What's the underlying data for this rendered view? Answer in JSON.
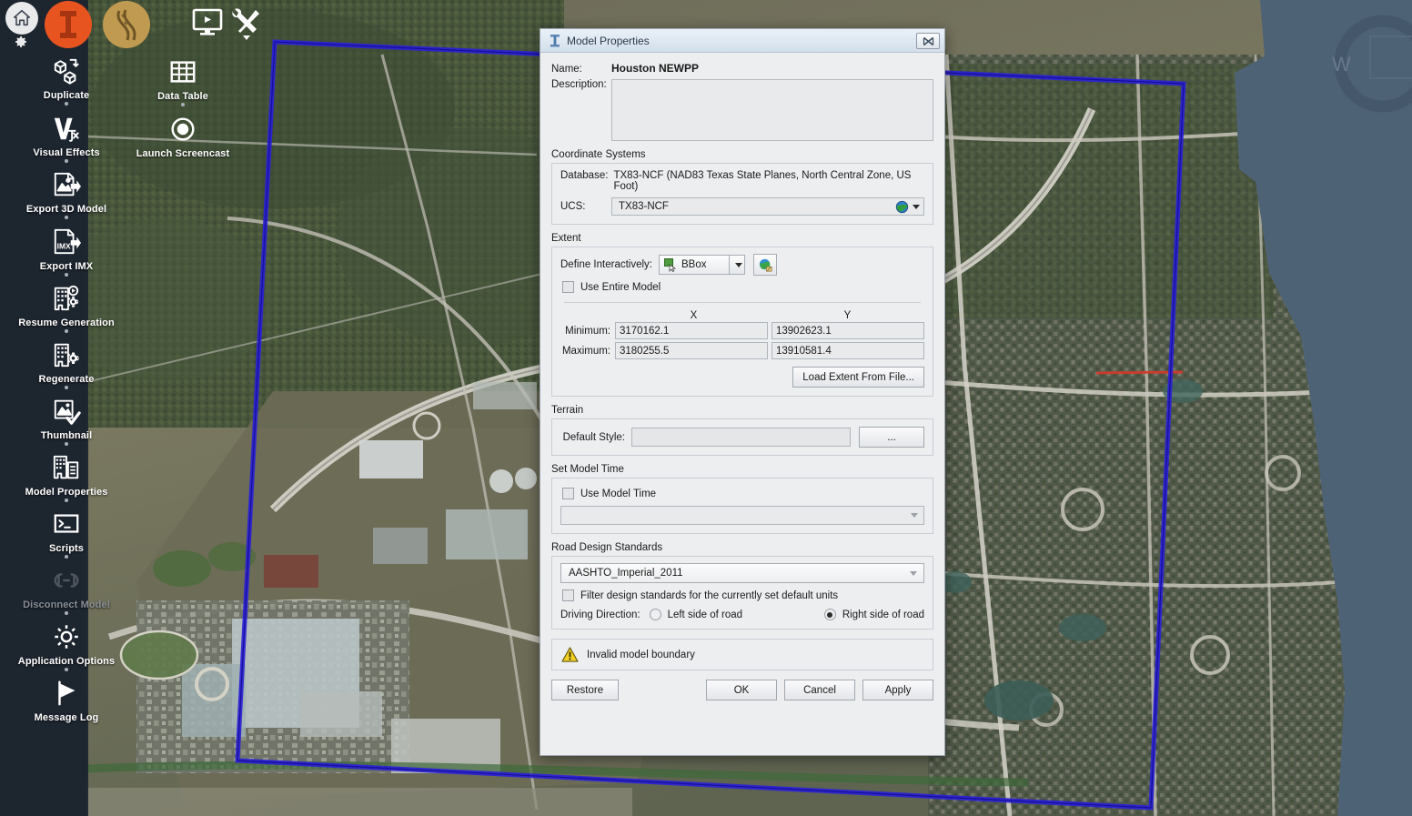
{
  "app": {
    "top_buttons": [
      {
        "name": "home-button",
        "icon": "home-icon",
        "label": "Home"
      },
      {
        "name": "settings-gear-button",
        "icon": "gear-icon",
        "label": "Settings"
      },
      {
        "name": "infraworks-logo-button",
        "icon": "infraworks-logo-icon",
        "label": "InfraWorks"
      },
      {
        "name": "roadway-design-button",
        "icon": "road-icon",
        "label": "Roadway Design"
      },
      {
        "name": "screencast-button",
        "icon": "screencast-monitor-icon",
        "label": "Screencast"
      },
      {
        "name": "tools-button",
        "icon": "wrench-screwdriver-icon",
        "label": "Tools"
      }
    ],
    "viewcube_label": "W"
  },
  "sidebar": {
    "column1": [
      {
        "label": "Duplicate",
        "icon": "duplicate-cubes-icon",
        "disabled": false
      },
      {
        "label": "Visual Effects",
        "icon": "visual-effects-icon",
        "disabled": false
      },
      {
        "label": "Export 3D Model",
        "icon": "export-3d-model-icon",
        "disabled": false
      },
      {
        "label": "Export IMX",
        "icon": "export-imx-icon",
        "disabled": false
      },
      {
        "label": "Resume Generation",
        "icon": "resume-generation-icon",
        "disabled": false
      },
      {
        "label": "Regenerate",
        "icon": "regenerate-icon",
        "disabled": false
      },
      {
        "label": "Thumbnail",
        "icon": "thumbnail-icon",
        "disabled": false
      },
      {
        "label": "Model Properties",
        "icon": "model-properties-icon",
        "disabled": false
      },
      {
        "label": "Scripts",
        "icon": "scripts-console-icon",
        "disabled": false
      },
      {
        "label": "Disconnect Model",
        "icon": "disconnect-model-icon",
        "disabled": true
      },
      {
        "label": "Application Options",
        "icon": "application-options-gear-icon",
        "disabled": false
      },
      {
        "label": "Message Log",
        "icon": "message-log-flag-icon",
        "disabled": false
      }
    ],
    "column2": [
      {
        "label": "Data Table",
        "icon": "data-table-grid-icon",
        "disabled": false
      },
      {
        "label": "Launch Screencast",
        "icon": "launch-screencast-record-icon",
        "disabled": false
      }
    ]
  },
  "dialog": {
    "title": "Model Properties",
    "title_icon": "model-properties-icon",
    "close_icon": "close-icon",
    "name_label": "Name:",
    "name_value": "Houston NEWPP",
    "description_label": "Description:",
    "description_value": "",
    "coordinate_systems": {
      "group_label": "Coordinate Systems",
      "database_label": "Database:",
      "database_value": "TX83-NCF (NAD83 Texas State Planes, North Central Zone, US Foot)",
      "ucs_label": "UCS:",
      "ucs_value": "TX83-NCF",
      "ucs_icon": "globe-icon"
    },
    "extent": {
      "group_label": "Extent",
      "define_label": "Define Interactively:",
      "define_value": "BBox",
      "define_icon": "bbox-select-icon",
      "pick_icon": "pick-region-icon",
      "use_entire_model_label": "Use Entire Model",
      "use_entire_model_checked": false,
      "col_x": "X",
      "col_y": "Y",
      "minimum_label": "Minimum:",
      "maximum_label": "Maximum:",
      "min_x": "3170162.1",
      "min_y": "13902623.1",
      "max_x": "3180255.5",
      "max_y": "13910581.4",
      "load_extent_label": "Load Extent From File..."
    },
    "terrain": {
      "group_label": "Terrain",
      "default_style_label": "Default Style:",
      "default_style_value": "",
      "browse_label": "..."
    },
    "model_time": {
      "group_label": "Set Model Time",
      "use_model_time_label": "Use Model Time",
      "use_model_time_checked": false,
      "time_value": ""
    },
    "road_standards": {
      "group_label": "Road Design Standards",
      "standard_value": "AASHTO_Imperial_2011",
      "filter_label": "Filter design standards for the currently set default units",
      "filter_checked": false,
      "driving_direction_label": "Driving Direction:",
      "left_label": "Left side of road",
      "right_label": "Right side of road",
      "selected_side": "right"
    },
    "warning": {
      "icon": "warning-triangle-icon",
      "text": "Invalid model boundary"
    },
    "buttons": {
      "restore": "Restore",
      "ok": "OK",
      "cancel": "Cancel",
      "apply": "Apply"
    }
  },
  "colors": {
    "accent_orange": "#e8541f",
    "boundary_blue": "#2b21d8",
    "water_blue": "#4e6276",
    "sidebar_dark": "#1c232d",
    "warning_yellow": "#f2d024"
  }
}
